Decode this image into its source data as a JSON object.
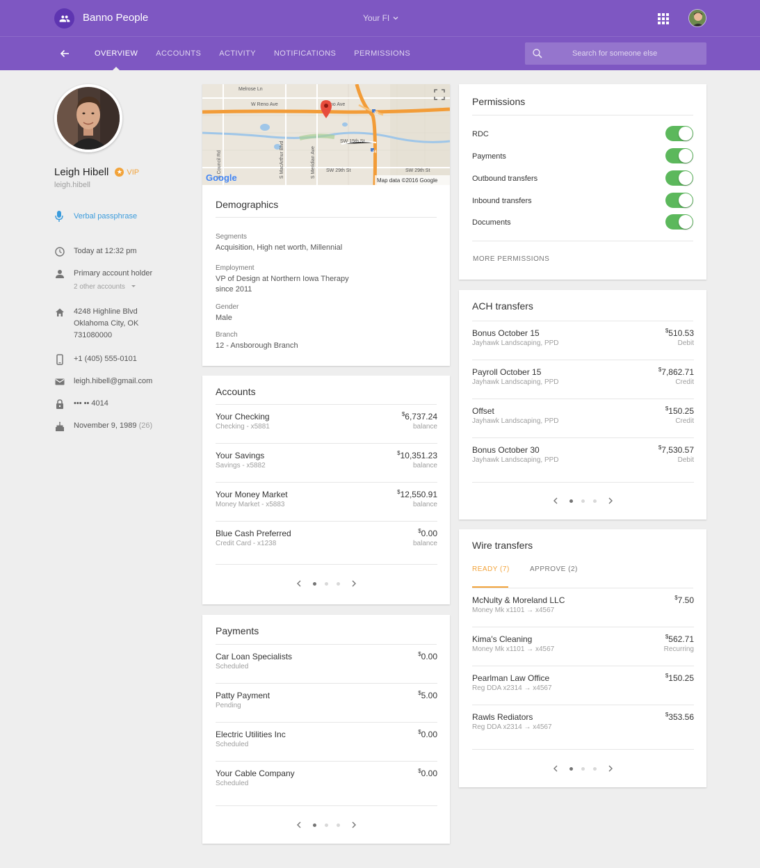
{
  "app": {
    "title": "Banno People",
    "fi_selector": "Your FI",
    "nav_tabs": [
      "OVERVIEW",
      "ACCOUNTS",
      "ACTIVITY",
      "NOTIFICATIONS",
      "PERMISSIONS"
    ],
    "active_tab": "OVERVIEW",
    "search_placeholder": "Search for someone else"
  },
  "profile": {
    "name": "Leigh Hibell",
    "vip": "VIP",
    "username": "leigh.hibell",
    "passphrase": "Verbal passphrase",
    "last_seen": "Today at 12:32 pm",
    "account_role": "Primary account holder",
    "other_accounts": "2 other accounts",
    "address_line1": "4248 Highline Blvd",
    "address_line2": "Oklahoma City, OK",
    "address_line3": "731080000",
    "phone": "+1 (405) 555-0101",
    "email": "leigh.hibell@gmail.com",
    "card_mask": "••• •• 4014",
    "birthday": "November 9, 1989",
    "age": "(26)"
  },
  "map": {
    "streets": [
      "Melrose Ln",
      "W Reno Ave",
      "no Ave",
      "SW 15th St",
      "SW 29th St",
      "SW 29th St",
      "S Council Rd",
      "S MacArthur Blvd",
      "S Meridian Ave"
    ],
    "highway_40": "40",
    "highway_44": "44",
    "google": "Google",
    "attribution": "Map data ©2016 Google"
  },
  "demographics": {
    "title": "Demographics",
    "segments_label": "Segments",
    "segments": "Acquisition, High net worth, Millennial",
    "employment_label": "Employment",
    "employment_line1": "VP of Design at Northern Iowa Therapy",
    "employment_line2": "since 2011",
    "gender_label": "Gender",
    "gender": "Male",
    "branch_label": "Branch",
    "branch": "12 - Ansborough Branch"
  },
  "accounts": {
    "title": "Accounts",
    "items": [
      {
        "name": "Your Checking",
        "sub": "Checking  -  x5881",
        "amount": "6,737.24",
        "note": "balance"
      },
      {
        "name": "Your Savings",
        "sub": "Savings  -  x5882",
        "amount": "10,351.23",
        "note": "balance"
      },
      {
        "name": "Your Money Market",
        "sub": "Money Market  -  x5883",
        "amount": "12,550.91",
        "note": "balance"
      },
      {
        "name": "Blue Cash Preferred",
        "sub": "Credit Card - x1238",
        "amount": "0.00",
        "note": "balance"
      }
    ]
  },
  "payments": {
    "title": "Payments",
    "items": [
      {
        "name": "Car Loan Specialists",
        "sub": "Scheduled",
        "amount": "0.00"
      },
      {
        "name": "Patty Payment",
        "sub": "Pending",
        "amount": "5.00"
      },
      {
        "name": "Electric Utilities Inc",
        "sub": "Scheduled",
        "amount": "0.00"
      },
      {
        "name": "Your Cable Company",
        "sub": "Scheduled",
        "amount": "0.00"
      }
    ]
  },
  "permissions": {
    "title": "Permissions",
    "items": [
      {
        "label": "RDC",
        "enabled": true
      },
      {
        "label": "Payments",
        "enabled": true
      },
      {
        "label": "Outbound transfers",
        "enabled": true
      },
      {
        "label": "Inbound transfers",
        "enabled": true
      },
      {
        "label": "Documents",
        "enabled": true
      }
    ],
    "more": "MORE PERMISSIONS"
  },
  "ach": {
    "title": "ACH transfers",
    "items": [
      {
        "name": "Bonus October 15",
        "sub": "Jayhawk Landscaping, PPD",
        "amount": "510.53",
        "note": "Debit"
      },
      {
        "name": "Payroll October 15",
        "sub": "Jayhawk Landscaping, PPD",
        "amount": "7,862.71",
        "note": "Credit"
      },
      {
        "name": "Offset",
        "sub": "Jayhawk Landscaping, PPD",
        "amount": "150.25",
        "note": "Credit"
      },
      {
        "name": "Bonus October 30",
        "sub": "Jayhawk Landscaping, PPD",
        "amount": "7,530.57",
        "note": "Debit"
      }
    ]
  },
  "wire": {
    "title": "Wire transfers",
    "tab_ready": "READY (7)",
    "tab_approve": "APPROVE (2)",
    "items": [
      {
        "name": "McNulty & Moreland LLC",
        "sub": "Money Mk x1101 → x4567",
        "amount": "7.50",
        "note": ""
      },
      {
        "name": "Kima's Cleaning",
        "sub": "Money Mk x1101 → x4567",
        "amount": "562.71",
        "note": "Recurring"
      },
      {
        "name": "Pearlman Law Office",
        "sub": "Reg DDA x2314 → x4567",
        "amount": "150.25",
        "note": ""
      },
      {
        "name": "Rawls Rediators",
        "sub": "Reg DDA x2314 → x4567",
        "amount": "353.56",
        "note": ""
      }
    ]
  },
  "currency_symbol": "$",
  "colors": {
    "primary": "#7e57c2",
    "accent": "#f2a33a",
    "toggle_on": "#5cb85c",
    "link": "#3a9bdc"
  }
}
